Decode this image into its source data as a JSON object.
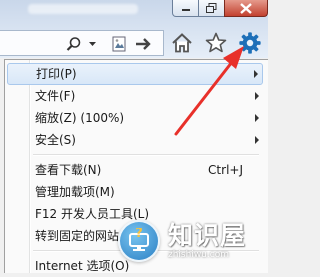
{
  "menu": {
    "items": [
      {
        "label": "打印(P)",
        "has_submenu": true,
        "highlighted": true
      },
      {
        "label": "文件(F)",
        "has_submenu": true
      },
      {
        "label": "缩放(Z) (100%)",
        "has_submenu": true
      },
      {
        "label": "安全(S)",
        "has_submenu": true
      },
      {
        "label": "查看下载(N)",
        "shortcut": "Ctrl+J"
      },
      {
        "label": "管理加载项(M)"
      },
      {
        "label": "F12 开发人员工具(L)"
      },
      {
        "label": "转到固定的网站(G)"
      },
      {
        "label": "Internet 选项(O)"
      }
    ]
  },
  "annotation": {
    "arrow_color": "#e8302a"
  },
  "watermark": {
    "text": "知识屋",
    "url": "zhishiwu.com"
  }
}
